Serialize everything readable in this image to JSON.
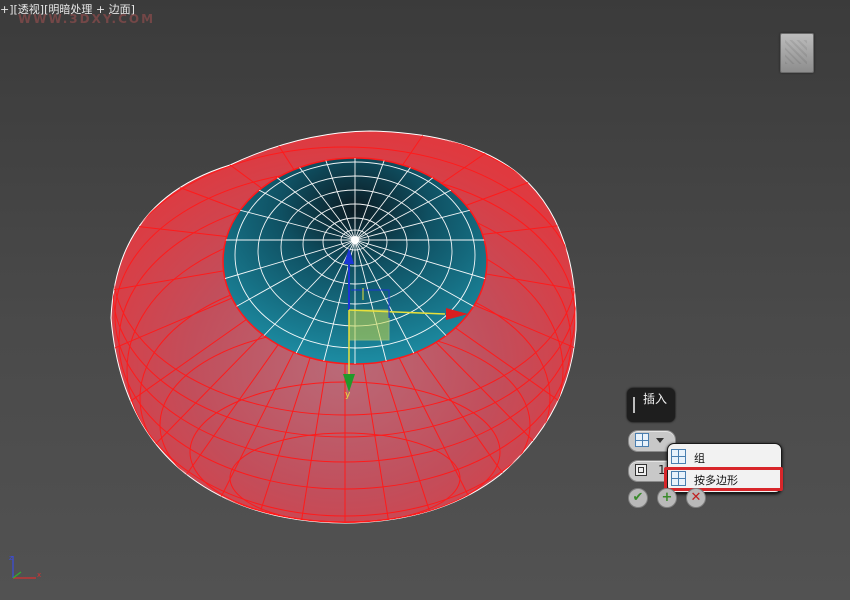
{
  "viewport": {
    "label": "+][透视][明暗处理 + 边面]",
    "watermark": "WWW.3DXY.COM"
  },
  "caddy": {
    "title": "插入",
    "mode_icon": "insert-by-group-icon",
    "amount_value": "1",
    "options": [
      {
        "label": "组",
        "icon": "group-icon"
      },
      {
        "label": "按多边形",
        "icon": "by-polygon-icon",
        "highlighted": true
      }
    ],
    "buttons": [
      {
        "name": "ok",
        "icon": "checkmark-icon"
      },
      {
        "name": "apply",
        "icon": "plus-icon"
      },
      {
        "name": "cancel",
        "icon": "x-icon"
      }
    ]
  },
  "axis": {
    "x": "x",
    "z": "z"
  },
  "colors": {
    "dome": "#e0393f",
    "wire": "#ff1a1a",
    "inner": "#127d98",
    "highlight": "#d8262a"
  }
}
